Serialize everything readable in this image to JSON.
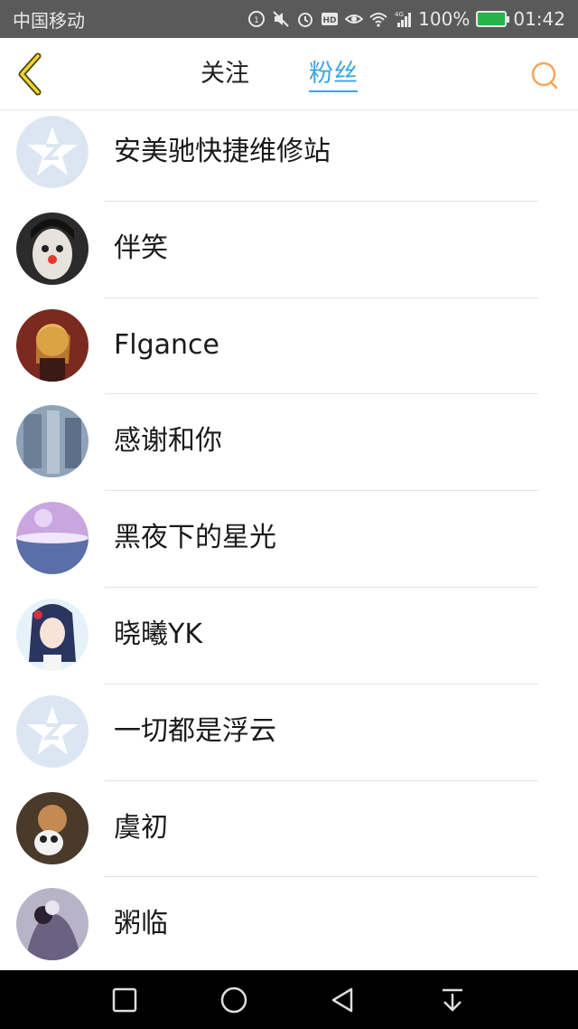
{
  "status_bar": {
    "carrier": "中国移动",
    "network": "4G",
    "battery": "100%",
    "time": "01:42",
    "icons": [
      "hd-icon",
      "mute-icon",
      "alarm-icon",
      "eye-icon",
      "wifi-icon",
      "signal-icon",
      "battery-icon"
    ]
  },
  "header": {
    "tabs": [
      {
        "label": "关注",
        "active": false
      },
      {
        "label": "粉丝",
        "active": true
      }
    ],
    "back_icon": "chevron-left-icon",
    "search_icon": "search-icon",
    "accent_color": "#3ba4e6"
  },
  "fans": [
    {
      "name": "安美驰快捷维修站",
      "avatar": "default-avatar"
    },
    {
      "name": "伴笑",
      "avatar": "photo-avatar"
    },
    {
      "name": "Flgance",
      "avatar": "photo-avatar"
    },
    {
      "name": "感谢和你",
      "avatar": "photo-avatar"
    },
    {
      "name": "黑夜下的星光",
      "avatar": "photo-avatar"
    },
    {
      "name": "晓曦YK",
      "avatar": "photo-avatar"
    },
    {
      "name": "一切都是浮云",
      "avatar": "default-avatar"
    },
    {
      "name": "虞初",
      "avatar": "photo-avatar"
    },
    {
      "name": "粥临",
      "avatar": "photo-avatar"
    }
  ],
  "nav_bar": {
    "buttons": [
      "recent-apps-icon",
      "home-icon",
      "back-icon",
      "notification-pull-icon"
    ]
  }
}
